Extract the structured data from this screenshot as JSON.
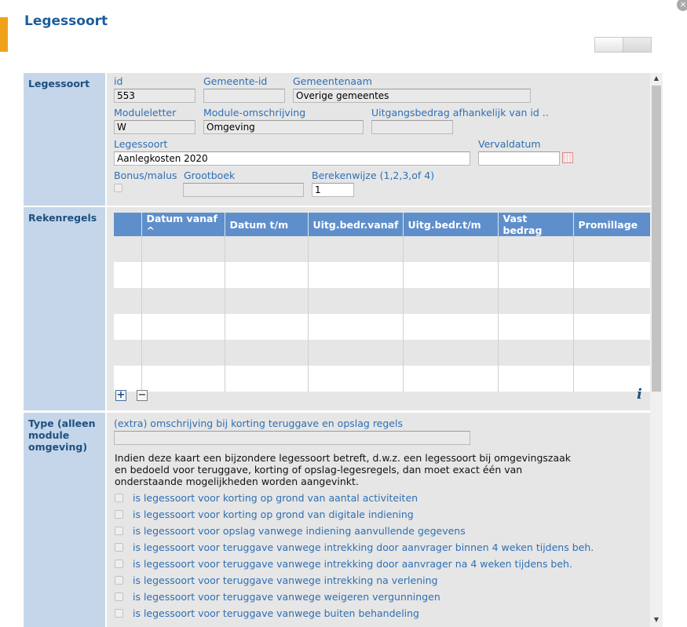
{
  "dialog": {
    "title": "Legessoort",
    "close_glyph": "×"
  },
  "sections": {
    "legessoort": {
      "label": "Legessoort",
      "fields": {
        "id": {
          "label": "id",
          "value": "553"
        },
        "gemeente_id": {
          "label": "Gemeente-id",
          "value": ""
        },
        "gemeentenaam": {
          "label": "Gemeentenaam",
          "value": "Overige gemeentes"
        },
        "moduleletter": {
          "label": "Moduleletter",
          "value": "W"
        },
        "module_omschrijving": {
          "label": "Module-omschrijving",
          "value": "Omgeving"
        },
        "uitgangsbedrag": {
          "label": "Uitgangsbedrag afhankelijk van id ..",
          "value": ""
        },
        "legessoort": {
          "label": "Legessoort",
          "value": "Aanlegkosten 2020"
        },
        "vervaldatum": {
          "label": "Vervaldatum",
          "value": ""
        },
        "bonus_malus": {
          "label": "Bonus/malus",
          "checked": false
        },
        "grootboek": {
          "label": "Grootboek",
          "value": ""
        },
        "berekenwijze": {
          "label": "Berekenwijze (1,2,3,of 4)",
          "value": "1"
        }
      }
    },
    "rekenregels": {
      "label": "Rekenregels",
      "columns": [
        "",
        "Datum vanaf ^",
        "Datum t/m",
        "Uitg.bedr.vanaf",
        "Uitg.bedr.t/m",
        "Vast bedrag",
        "Promillage"
      ],
      "add_glyph": "+",
      "remove_glyph": "−",
      "info_glyph": "i"
    },
    "type": {
      "label": "Type (alleen module omgeving)",
      "omschrijving": {
        "label": "(extra) omschrijving bij korting teruggave en opslag regels",
        "value": ""
      },
      "explanation": "Indien deze kaart een bijzondere legessoort betreft, d.w.z. een legessoort bij omgevingszaak en bedoeld voor teruggave, korting of opslag-legesregels, dan moet exact één van onderstaande mogelijkheden worden aangevinkt.",
      "options": [
        {
          "label": "is legessoort voor korting op grond van aantal activiteiten",
          "checked": false
        },
        {
          "label": "is legessoort voor korting op grond van digitale indiening",
          "checked": false
        },
        {
          "label": "is legessoort voor opslag vanwege indiening aanvullende gegevens",
          "checked": false
        },
        {
          "label": "is legessoort voor teruggave vanwege intrekking door aanvrager binnen 4 weken tijdens beh.",
          "checked": false
        },
        {
          "label": "is legessoort voor teruggave vanwege intrekking door aanvrager na 4 weken tijdens beh.",
          "checked": false
        },
        {
          "label": "is legessoort voor teruggave vanwege intrekking na verlening",
          "checked": false
        },
        {
          "label": "is legessoort voor teruggave vanwege weigeren vergunningen",
          "checked": false
        },
        {
          "label": "is legessoort voor teruggave vanwege buiten behandeling",
          "checked": false
        }
      ]
    }
  },
  "scrollbar": {
    "up_glyph": "▲",
    "down_glyph": "▼"
  },
  "colors": {
    "accent": "#f0a11a",
    "title": "#1d5d9b",
    "side_panel": "#c5d6ea",
    "grid_header": "#5f8fcb",
    "label": "#2e6fb3"
  }
}
